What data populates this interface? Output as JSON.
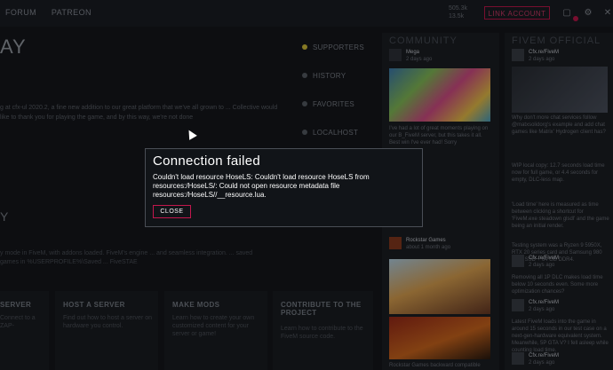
{
  "topbar": {
    "nav": [
      "FORUM",
      "PATREON"
    ],
    "stats": [
      "505.3k",
      "13.5k"
    ],
    "link_account": "LINK ACCOUNT"
  },
  "hero": {
    "title": "AY",
    "text": "g at cfx-ul 2020.2, a fine new addition to our great platform that we've all grown to ... Collective would like to thank you for playing the game, and by this way, we're not done"
  },
  "section2": {
    "title": "Y",
    "text": "y mode in FiveM, with addons loaded. FiveM's engine ... and seamless integration. ... saved games in %USERPROFILE%\\Saved ... FiveSTAE"
  },
  "tiles": [
    {
      "title": "SERVER",
      "text": "Connect to a ZAP-"
    },
    {
      "title": "HOST A SERVER",
      "text": "Find out how to host a server on hardware you control."
    },
    {
      "title": "MAKE MODS",
      "text": "Learn how to create your own customized content for your server or game!"
    },
    {
      "title": "CONTRIBUTE TO THE PROJECT",
      "text": "Learn how to contribute to the FiveM source code."
    }
  ],
  "sidenav": [
    {
      "label": "SUPPORTERS",
      "color": "#d8c43a"
    },
    {
      "label": "HISTORY",
      "color": "#5a5f68"
    },
    {
      "label": "FAVORITES",
      "color": "#5a5f68"
    },
    {
      "label": "LOCALHOST",
      "color": "#5a5f68"
    }
  ],
  "community": {
    "title": "COMMUNITY",
    "posts": [
      {
        "author": "Mega",
        "meta": "2 days ago"
      },
      {
        "text": "I've had a lot of great moments playing on our B_FiveM server, but this takes it all. Best win I've ever had! Sorry"
      },
      {
        "author": "Rockstar Games",
        "meta": "about 1 month ago"
      },
      {
        "text": "Rockstar Games backward compatible"
      }
    ]
  },
  "fivem_official": {
    "title": "FIVEM OFFICIAL",
    "posts": [
      {
        "author": "Cfx.re/FiveM",
        "meta": "2 days ago"
      },
      {
        "text": "Why don't more chat services follow @matxsolidorg's example and add chat games like Matrix' Hydrogen client has?"
      },
      {
        "text": "WIP local copy: 12.7 seconds load time now for full game, or 4.4 seconds for empty, DLC-less map."
      },
      {
        "text": "'Load time' here is measured as time between clicking a shortcut for 'FiveM.exe steadown glsdl' and the game being an initial render."
      },
      {
        "text": "Testing system was a Ryzen 9 5950X, RTX 20 series card and Samsung 980 PRO SSD + 64 GB DDR4."
      },
      {
        "author": "Cfx.re/FiveM",
        "meta": "2 days ago"
      },
      {
        "text": "Removing all 1P DLC makes load time below 10 seconds even. Some more optimization chances?"
      },
      {
        "author": "Cfx.re/FiveM",
        "meta": "2 days ago"
      },
      {
        "text": "Latest FiveM loads into the game in around 15 seconds in our test case on a next-gen-hardware equivalent system. Meanwhile, 5P GTA V? I fell asleep while counting load time."
      },
      {
        "author": "Cfx.re/FiveM",
        "meta": "2 days ago"
      }
    ]
  },
  "dialog": {
    "title": "Connection failed",
    "message": "Couldn't load resource HoseLS: Couldn't load resource HoseLS from resources:/HoseLS/: Could not open resource metadata file resources:/HoseLS//__resource.lua.",
    "close_label": "CLOSE"
  },
  "colors": {
    "accent": "#c2174d",
    "background": "#15171c"
  }
}
